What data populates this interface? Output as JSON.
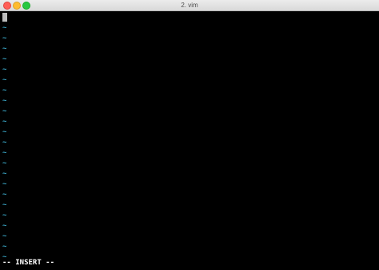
{
  "window": {
    "title": "2. vim"
  },
  "editor": {
    "empty_line_marker": "~",
    "empty_line_count": 23,
    "mode_indicator": "-- INSERT --"
  },
  "colors": {
    "background": "#000000",
    "tilde": "#3aa7c7",
    "cursor": "#bdbdbd",
    "status_text": "#ffffff"
  }
}
